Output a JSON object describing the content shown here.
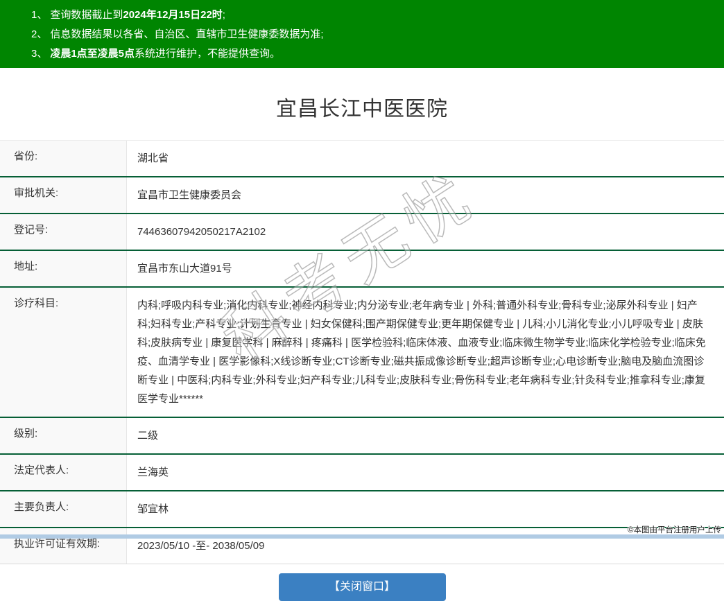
{
  "colors": {
    "banner_green": "#008501",
    "divider_green": "#065F36",
    "button_blue": "#3B80C2",
    "bottom_strip_blue": "#B0CBE4",
    "label_bg": "#F9F9F9"
  },
  "notice_bar": {
    "items": [
      {
        "num": "1、",
        "segments": [
          {
            "text": "查询数据截止到",
            "bold": false
          },
          {
            "text": "2024年12月15日22时",
            "bold": true
          },
          {
            "text": ";",
            "bold": false
          }
        ]
      },
      {
        "num": "2、",
        "segments": [
          {
            "text": "信息数据结果以各省、自治区、直辖市卫生健康委数据为准;",
            "bold": false
          }
        ]
      },
      {
        "num": "3、",
        "segments": [
          {
            "text": "凌晨1点至凌晨5点",
            "bold": true
          },
          {
            "text": "系统进行维护，不能提供查询。",
            "bold": false
          }
        ]
      }
    ]
  },
  "title": "宜昌长江中医医院",
  "table": {
    "rows": [
      {
        "label": "省份:",
        "value": "湖北省"
      },
      {
        "label": "审批机关:",
        "value": "宜昌市卫生健康委员会"
      },
      {
        "label": "登记号:",
        "value": "74463607942050217A2102"
      },
      {
        "label": "地址:",
        "value": "宜昌市东山大道91号"
      },
      {
        "label": "诊疗科目:",
        "value": "内科;呼吸内科专业;消化内科专业;神经内科专业;内分泌专业;老年病专业 | 外科;普通外科专业;骨科专业;泌尿外科专业 | 妇产科;妇科专业;产科专业;计划生育专业 | 妇女保健科;围产期保健专业;更年期保健专业 | 儿科;小儿消化专业;小儿呼吸专业 | 皮肤科;皮肤病专业 | 康复医学科 | 麻醉科 | 疼痛科 | 医学检验科;临床体液、血液专业;临床微生物学专业;临床化学检验专业;临床免疫、血清学专业 | 医学影像科;X线诊断专业;CT诊断专业;磁共振成像诊断专业;超声诊断专业;心电诊断专业;脑电及脑血流图诊断专业 | 中医科;内科专业;外科专业;妇产科专业;儿科专业;皮肤科专业;骨伤科专业;老年病科专业;针灸科专业;推拿科专业;康复医学专业******"
      },
      {
        "label": "级别:",
        "value": "二级"
      },
      {
        "label": "法定代表人:",
        "value": "兰海英"
      },
      {
        "label": "主要负责人:",
        "value": "邹宜林"
      },
      {
        "label": "执业许可证有效期:",
        "value": "2023/05/10 -至- 2038/05/09"
      }
    ]
  },
  "watermark": {
    "diagonal_text": "科考无忧",
    "photo_credit": "©本图由平台注册用户上传"
  },
  "footer": {
    "close_button_label": "【关闭窗口】"
  }
}
